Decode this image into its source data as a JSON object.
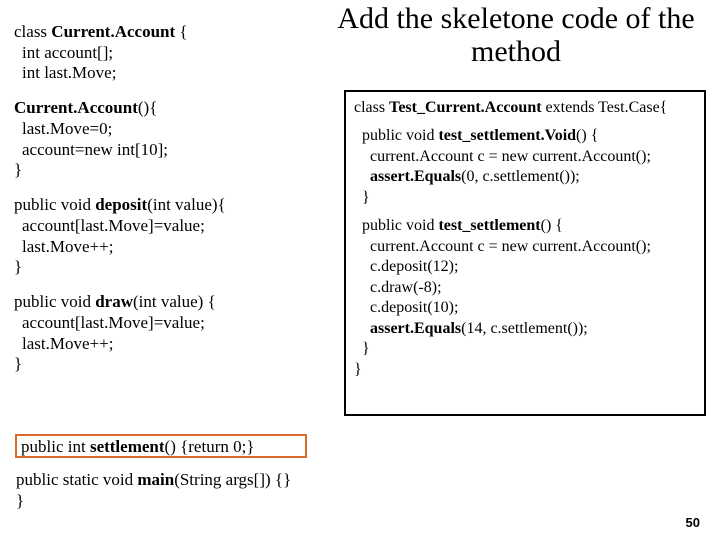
{
  "title": "Add the skeletone code of the method",
  "left": {
    "l1a": "class ",
    "l1b": "Current.Account",
    "l1c": " {",
    "l2": "int account[];",
    "l3": "int last.Move;",
    "c1a": "Current.Account",
    "c1b": "(){",
    "c2": "last.Move=0;",
    "c3": "account=new int[10];",
    "c4": "}",
    "d1a": "public void ",
    "d1b": "deposit",
    "d1c": "(int value){",
    "d2": "account[last.Move]=value;",
    "d3": "last.Move++;",
    "d4": "}",
    "w1a": "public void ",
    "w1b": "draw",
    "w1c": "(int value) {",
    "w2": "account[last.Move]=value;",
    "w3": "last.Move++;",
    "w4": "}",
    "s1a": "public int ",
    "s1b": "settlement",
    "s1c": "() {return 0;}",
    "m1a": "public static void ",
    "m1b": "main",
    "m1c": "(String args[]) {}",
    "m2": "}"
  },
  "right": {
    "r1a": "class ",
    "r1b": "Test_Current.Account",
    "r1c": " extends Test.Case{",
    "t1a": "public void ",
    "t1b": "test_settlement.Void",
    "t1c": "() {",
    "t2": "current.Account c = new current.Account();",
    "t3a": "assert.Equals",
    "t3b": "(0, c.settlement());",
    "t4": "}",
    "u1a": "public void ",
    "u1b": "test_settlement",
    "u1c": "() {",
    "u2": "current.Account c = new current.Account();",
    "u3": "c.deposit(12);",
    "u4": "c.draw(-8);",
    "u5": "c.deposit(10);",
    "u6a": "assert.Equals",
    "u6b": "(14, c.settlement());",
    "u7": "}",
    "u8": "}"
  },
  "page": "50"
}
